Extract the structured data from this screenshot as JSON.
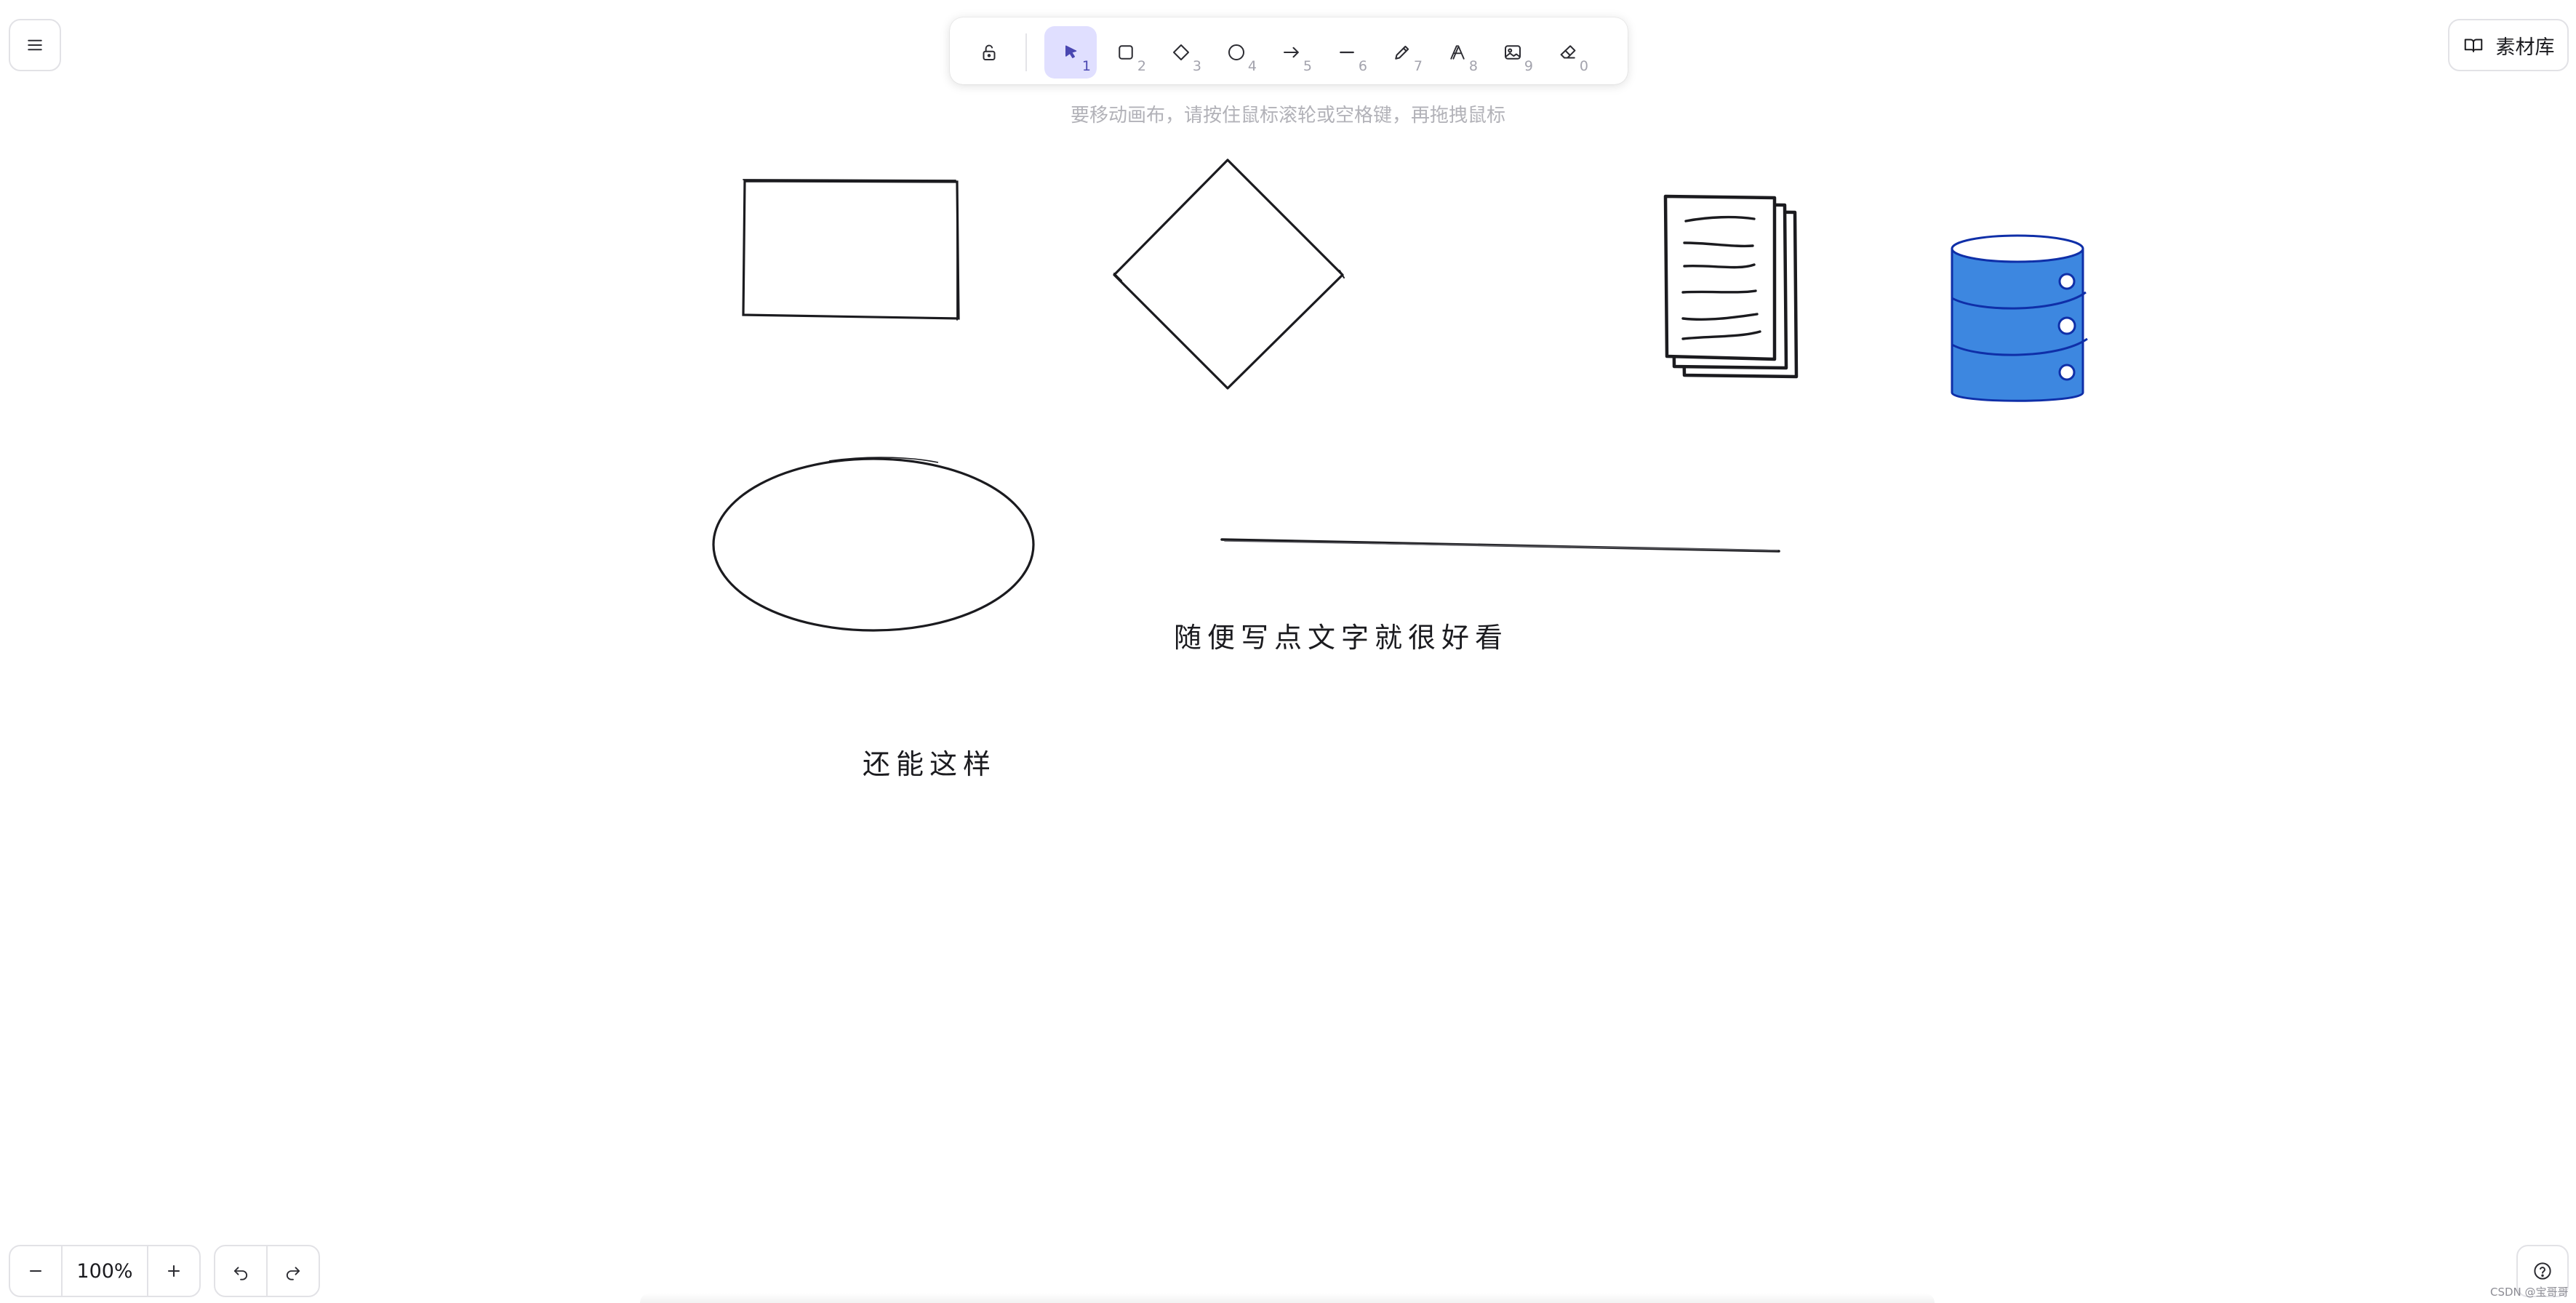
{
  "menu": {
    "icon": "hamburger-menu-icon"
  },
  "toolbar": {
    "tools": [
      {
        "name": "lock",
        "icon": "unlock-icon",
        "key": ""
      },
      {
        "name": "selection",
        "icon": "pointer-icon",
        "key": "1",
        "active": true
      },
      {
        "name": "rectangle",
        "icon": "rectangle-icon",
        "key": "2"
      },
      {
        "name": "diamond",
        "icon": "diamond-icon",
        "key": "3"
      },
      {
        "name": "ellipse",
        "icon": "circle-icon",
        "key": "4"
      },
      {
        "name": "arrow",
        "icon": "arrow-icon",
        "key": "5"
      },
      {
        "name": "line",
        "icon": "line-icon",
        "key": "6"
      },
      {
        "name": "draw",
        "icon": "pencil-icon",
        "key": "7"
      },
      {
        "name": "text",
        "icon": "text-icon",
        "key": "8"
      },
      {
        "name": "image",
        "icon": "image-icon",
        "key": "9"
      },
      {
        "name": "eraser",
        "icon": "eraser-icon",
        "key": "0"
      }
    ]
  },
  "hint": "要移动画布，请按住鼠标滚轮或空格键，再拖拽鼠标",
  "library": {
    "label": "素材库",
    "icon": "book-open-icon"
  },
  "canvas": {
    "texts": [
      "随便写点文字就很好看",
      "还能这样"
    ],
    "database_color": "#3d87e0",
    "stroke_color": "#1b1b1f"
  },
  "zoom": {
    "level": "100%"
  },
  "history": {
    "undo_icon": "undo-icon",
    "redo_icon": "redo-icon"
  },
  "help": {
    "icon": "help-icon"
  },
  "watermark": "CSDN @宝哥哥"
}
